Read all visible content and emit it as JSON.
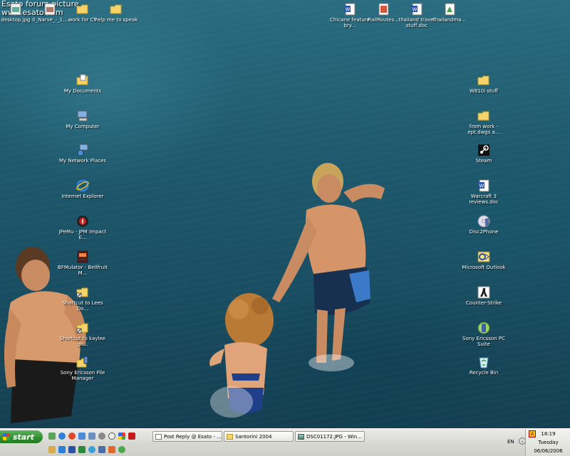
{
  "watermark": {
    "line1": "Esato forum picture",
    "line2": "www.esato.com"
  },
  "desktop_icons": [
    {
      "label": "desktop.jpg",
      "icon": "image-file-icon"
    },
    {
      "label": "0_Narve_-_1...",
      "icon": "image-file-icon"
    },
    {
      "label": "work for CV",
      "icon": "folder-icon"
    },
    {
      "label": "help me to speak",
      "icon": "folder-icon"
    },
    {
      "label": "Chicane feature bry...",
      "icon": "word-document-icon"
    },
    {
      "label": "RailRoutes...",
      "icon": "file-icon"
    },
    {
      "label": "thailand travel stuff.doc",
      "icon": "word-document-icon"
    },
    {
      "label": "thailandma...",
      "icon": "file-icon"
    },
    {
      "label": "My Documents",
      "icon": "my-documents-icon"
    },
    {
      "label": "My Computer",
      "icon": "my-computer-icon"
    },
    {
      "label": "My Network Places",
      "icon": "network-places-icon"
    },
    {
      "label": "Internet Explorer",
      "icon": "internet-explorer-icon"
    },
    {
      "label": "JPeMu - JPM Impact E...",
      "icon": "emulator-icon"
    },
    {
      "label": "BFMulator - Bellfruit M...",
      "icon": "emulator-icon"
    },
    {
      "label": "Shortcut to Lees Do...",
      "icon": "folder-shortcut-icon"
    },
    {
      "label": "Shortcut to kaylee gh...",
      "icon": "folder-shortcut-icon"
    },
    {
      "label": "Sony Ericsson File Manager",
      "icon": "file-manager-icon"
    },
    {
      "label": "W810i stuff",
      "icon": "folder-icon"
    },
    {
      "label": "from work - ept.dwgs a...",
      "icon": "folder-icon"
    },
    {
      "label": "Steam",
      "icon": "steam-icon"
    },
    {
      "label": "Warcraft 3 reviews.doc",
      "icon": "word-document-icon"
    },
    {
      "label": "Disc2Phone",
      "icon": "disc2phone-icon"
    },
    {
      "label": "Microsoft Outlook",
      "icon": "outlook-icon"
    },
    {
      "label": "Counter-Strike",
      "icon": "counter-strike-icon"
    },
    {
      "label": "Sony Ericsson PC Suite",
      "icon": "pc-suite-icon"
    },
    {
      "label": "Recycle Bin",
      "icon": "recycle-bin-icon"
    }
  ],
  "taskbar": {
    "start_label": "start",
    "tasks": [
      {
        "label": "Post Reply @ Esato - ...",
        "icon": "browser-page-icon"
      },
      {
        "label": "Santorini 2004",
        "icon": "folder-icon"
      },
      {
        "label": "DSC01172.JPG - Win...",
        "icon": "image-viewer-icon"
      }
    ],
    "language": "EN",
    "clock": {
      "time": "18:19",
      "day": "Tuesday",
      "date": "06/06/2006"
    }
  }
}
